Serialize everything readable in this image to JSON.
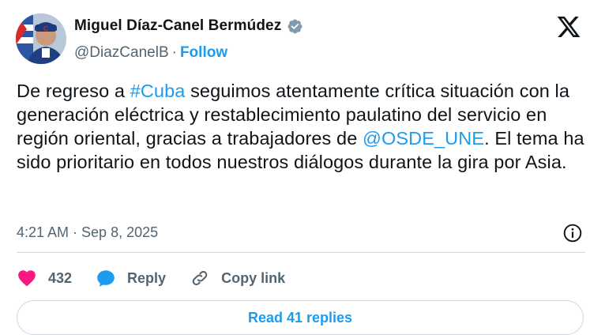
{
  "author": {
    "name": "Miguel Díaz-Canel Bermúdez",
    "handle": "@DiazCanelB",
    "separator": "·",
    "follow_label": "Follow"
  },
  "tweet": {
    "part1": "De regreso a ",
    "hashtag": "#Cuba",
    "part2": " seguimos atentamente crítica situación con la generación eléctrica y  restablecimiento paulatino del servicio en región oriental, gracias a trabajadores de ",
    "mention": "@OSDE_UNE",
    "part3": ". El tema ha sido prioritario en todos nuestros diálogos durante la gira por Asia."
  },
  "meta": {
    "timestamp": "4:21 AM · Sep 8, 2025"
  },
  "actions": {
    "likes": "432",
    "reply_label": "Reply",
    "copy_link_label": "Copy link"
  },
  "read_replies_label": "Read 41 replies",
  "colors": {
    "accent": "#1d9bf0",
    "like": "#f91880",
    "muted": "#536471"
  },
  "icons": [
    "verified-badge-icon",
    "x-logo-icon",
    "info-icon",
    "heart-icon",
    "reply-bubble-icon",
    "link-icon"
  ]
}
